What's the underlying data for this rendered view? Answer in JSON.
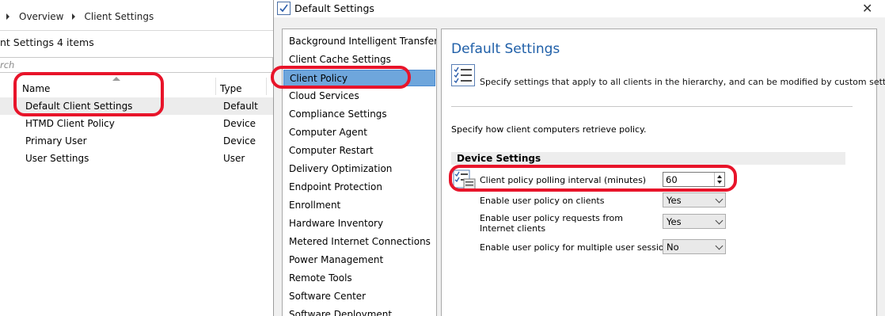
{
  "console": {
    "breadcrumb": [
      "Overview",
      "Client Settings"
    ],
    "title": "nt Settings 4 items",
    "search_placeholder": "rch",
    "columns": {
      "name": "Name",
      "type": "Type"
    },
    "rows": [
      {
        "name": "Default Client Settings",
        "type": "Default"
      },
      {
        "name": "HTMD Client Policy",
        "type": "Device"
      },
      {
        "name": "Primary User",
        "type": "Device"
      },
      {
        "name": "User Settings",
        "type": "User"
      }
    ]
  },
  "dialog": {
    "title": "Default Settings",
    "close_glyph": "✕",
    "nav_items": [
      "Background Intelligent Transfer",
      "Client Cache Settings",
      "Client Policy",
      "Cloud Services",
      "Compliance Settings",
      "Computer Agent",
      "Computer Restart",
      "Delivery Optimization",
      "Endpoint Protection",
      "Enrollment",
      "Hardware Inventory",
      "Metered Internet Connections",
      "Power Management",
      "Remote Tools",
      "Software Center",
      "Software Deployment"
    ],
    "active_nav": "Client Policy",
    "content": {
      "heading": "Default Settings",
      "description": "Specify settings that apply to all clients in the hierarchy, and can be modified by custom settings.",
      "retrieve_text": "Specify how client computers retrieve policy.",
      "group_title": "Device Settings",
      "settings": [
        {
          "label": "Client policy polling interval (minutes)",
          "value": "60",
          "control": "spinner"
        },
        {
          "label": "Enable user policy on clients",
          "value": "Yes",
          "control": "dropdown"
        },
        {
          "label": "Enable user policy requests from Internet clients",
          "value": "Yes",
          "control": "dropdown"
        },
        {
          "label": "Enable user policy for multiple user sessions",
          "value": "No",
          "control": "dropdown"
        }
      ]
    }
  },
  "colors": {
    "accent_blue": "#1f5fa8",
    "selection_blue": "#6ea6dc",
    "annotation_red": "#e8142a"
  },
  "icons": [
    "breadcrumb-arrow-icon",
    "sort-ascending-icon",
    "checklist-icon",
    "settings-list-icon",
    "close-icon",
    "spinner-up-icon",
    "spinner-down-icon",
    "chevron-down-icon"
  ]
}
